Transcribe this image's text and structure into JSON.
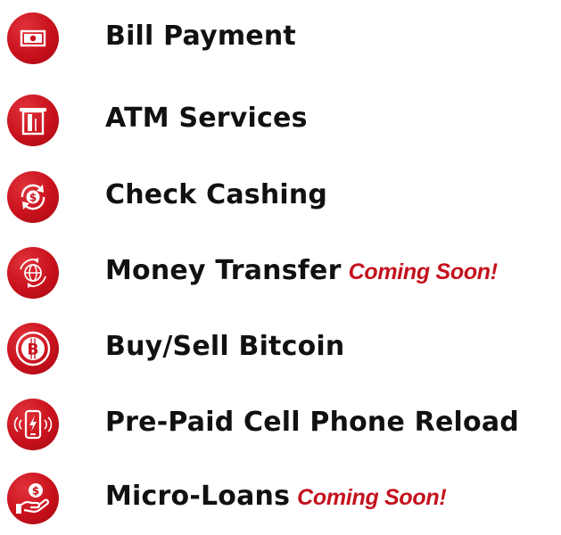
{
  "services": [
    {
      "label": "Bill Payment",
      "icon": "cash-bill-icon",
      "note": ""
    },
    {
      "label": "ATM Services",
      "icon": "atm-icon",
      "note": ""
    },
    {
      "label": "Check Cashing",
      "icon": "dollar-exchange-icon",
      "note": ""
    },
    {
      "label": "Money Transfer",
      "icon": "globe-transfer-icon",
      "note": "Coming Soon!"
    },
    {
      "label": "Buy/Sell Bitcoin",
      "icon": "bitcoin-icon",
      "note": ""
    },
    {
      "label": "Pre-Paid Cell Phone Reload",
      "icon": "phone-reload-icon",
      "note": ""
    },
    {
      "label": "Micro-Loans",
      "icon": "hand-coin-icon",
      "note": "Coming Soon!"
    }
  ],
  "colors": {
    "accent": "#c8111c",
    "text": "#111111",
    "coming_soon": "#c4121d"
  }
}
